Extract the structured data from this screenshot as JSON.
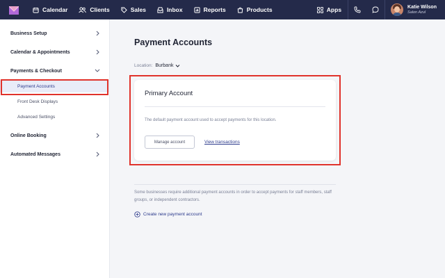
{
  "topnav": {
    "items": [
      {
        "label": "Calendar",
        "icon": "calendar-icon"
      },
      {
        "label": "Clients",
        "icon": "users-icon"
      },
      {
        "label": "Sales",
        "icon": "tag-icon"
      },
      {
        "label": "Inbox",
        "icon": "inbox-icon"
      },
      {
        "label": "Reports",
        "icon": "bar-chart-icon"
      },
      {
        "label": "Products",
        "icon": "bag-icon"
      }
    ],
    "apps_label": "Apps",
    "user": {
      "name": "Katie Wilson",
      "business": "Salon Azul"
    }
  },
  "sidebar": {
    "groups": [
      {
        "label": "Business Setup",
        "expanded": false
      },
      {
        "label": "Calendar & Appointments",
        "expanded": false
      },
      {
        "label": "Payments & Checkout",
        "expanded": true
      },
      {
        "label": "Online Booking",
        "expanded": false
      },
      {
        "label": "Automated Messages",
        "expanded": false
      }
    ],
    "payments_children": [
      {
        "label": "Payment Accounts",
        "active": true
      },
      {
        "label": "Front Desk Displays",
        "active": false
      },
      {
        "label": "Advanced Settings",
        "active": false
      }
    ]
  },
  "main": {
    "title": "Payment Accounts",
    "location_label": "Location:",
    "location_value": "Burbank",
    "card": {
      "title": "Primary Account",
      "description": "The default payment account used to accept payments for this location.",
      "manage_button": "Manage account",
      "view_link": "View transactions"
    },
    "note": "Some businesses require additional payment accounts in order to accept payments for staff members, staff groups, or independent contractors.",
    "create_label": "Create new payment account"
  },
  "colors": {
    "topbar": "#242a4a",
    "accent": "#2c3a8c",
    "highlight": "#e0322b"
  }
}
